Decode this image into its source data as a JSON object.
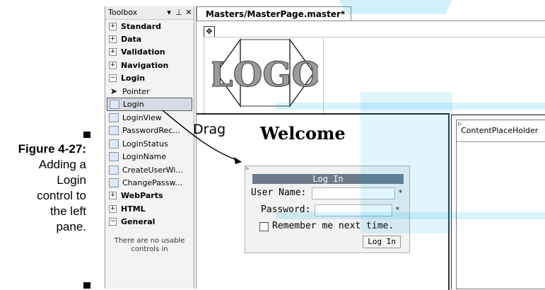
{
  "caption": {
    "figure": "Figure 4-27:",
    "lines": [
      "Adding a",
      "Login",
      "control to",
      "the left",
      "pane."
    ]
  },
  "toolbox": {
    "title": "Toolbox",
    "controls": [
      "▾",
      "⊥",
      "✕"
    ],
    "groups": [
      {
        "label": "Standard",
        "expander": "+"
      },
      {
        "label": "Data",
        "expander": "+"
      },
      {
        "label": "Validation",
        "expander": "+"
      },
      {
        "label": "Navigation",
        "expander": "+"
      },
      {
        "label": "Login",
        "expander": "−"
      }
    ],
    "items": [
      "Pointer",
      "Login",
      "LoginView",
      "PasswordRec...",
      "LoginStatus",
      "LoginName",
      "CreateUserWi...",
      "ChangePassw..."
    ],
    "groups_after": [
      {
        "label": "WebParts",
        "expander": "+"
      },
      {
        "label": "HTML",
        "expander": "+"
      },
      {
        "label": "General",
        "expander": "−"
      }
    ],
    "empty_text": "There are no usable controls in"
  },
  "designer": {
    "tab": "Masters/MasterPage.master*",
    "logo_text": "LOGO",
    "welcome": "Welcome",
    "content_placeholder": "ContentPlaceHolder",
    "login": {
      "title": "Log In",
      "username_label": "User Name:",
      "password_label": "Password:",
      "remember": "Remember me next time.",
      "button": "Log In",
      "required": "*"
    }
  },
  "annotation": {
    "drag": "Drag"
  },
  "colors": {
    "watermark": "#00aee8",
    "login_title_bar": "#6c7a8a",
    "selected_item": "#d7dbe6"
  }
}
